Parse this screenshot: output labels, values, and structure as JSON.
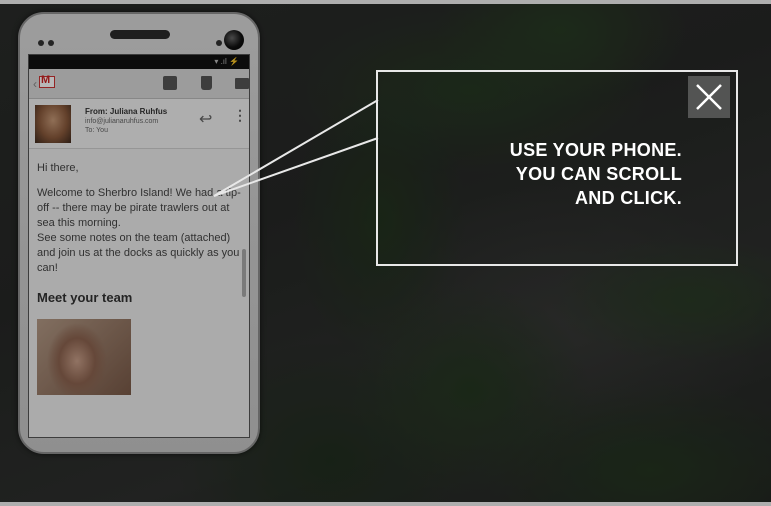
{
  "overlay": {
    "instruction_lines": [
      "USE YOUR PHONE.",
      "YOU CAN SCROLL",
      "AND CLICK."
    ],
    "close_label": "×"
  },
  "phone": {
    "status_icons": "▾ .ıl ⚡",
    "toolbar": {
      "back_glyph": "‹",
      "app_icon": "gmail-icon",
      "actions": [
        "archive-icon",
        "trash-icon",
        "mail-icon"
      ]
    },
    "email": {
      "from": "From: Juliana Ruhfus",
      "address": "info@julianaruhfus.com",
      "to": "To: You",
      "greeting": "Hi there,",
      "paragraph1": "Welcome to Sherbro Island! We had a tip-off -- there may be pirate trawlers out at sea this morning.",
      "paragraph2": "See some notes on the team (attached) and join us at the docks as quickly as you can!",
      "team_heading": "Meet your team"
    }
  },
  "colors": {
    "overlay_border": "#e8e8e8",
    "overlay_text": "#ffffff",
    "close_bg": "#828282",
    "gmail_red": "#c22222"
  }
}
